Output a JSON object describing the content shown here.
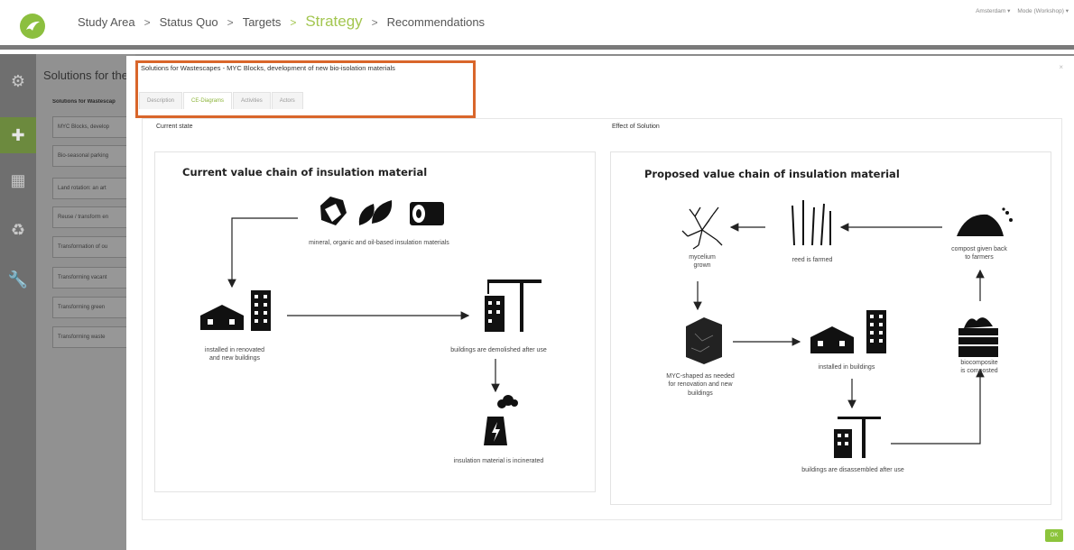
{
  "breadcrumb": {
    "items": [
      "Study Area",
      "Status Quo",
      "Targets",
      "Strategy",
      "Recommendations"
    ],
    "separator": ">"
  },
  "topright": {
    "city": "Amsterdam ▾",
    "mode": "Mode (Workshop) ▾"
  },
  "background": {
    "title": "Solutions for the",
    "subtitle": "Solutions for Wastescap",
    "items": [
      "MYC Blocks, develop",
      "Bio-seasonal parking",
      "Land rotation: an art",
      "Reuse / transform en",
      "Transformation of ou",
      "Transforming vacant",
      "Transforming green",
      "Transforming waste"
    ]
  },
  "modal": {
    "title": "Solutions for Wastescapes - MYC Blocks, development of new bio-isolation materials",
    "close": "×",
    "tabs": [
      "Description",
      "CE-Diagrams",
      "Activities",
      "Actors"
    ],
    "active_tab": "CE-Diagrams",
    "left_label": "Current state",
    "right_label": "Effect of Solution",
    "ok_label": "OK"
  },
  "current": {
    "title": "Current value chain of insulation material",
    "materials": "mineral, organic and oil-based insulation materials",
    "installed": "installed in renovated\nand new buildings",
    "demolished": "buildings are demolished after use",
    "incinerated": "insulation material is incinerated"
  },
  "proposed": {
    "title": "Proposed value chain of insulation material",
    "mycelium": "mycelium\ngrown",
    "reed": "reed is farmed",
    "compost": "compost given back\nto farmers",
    "shaped": "MYC-shaped as needed\nfor renovation and new\nbuildings",
    "installed": "installed in buildings",
    "biocomposite": "biocomposite\nis composted",
    "disassembled": "buildings are disassembled after use"
  },
  "colors": {
    "accent": "#a3c650",
    "highlight": "#d9662b",
    "ok": "#8cc43c"
  }
}
